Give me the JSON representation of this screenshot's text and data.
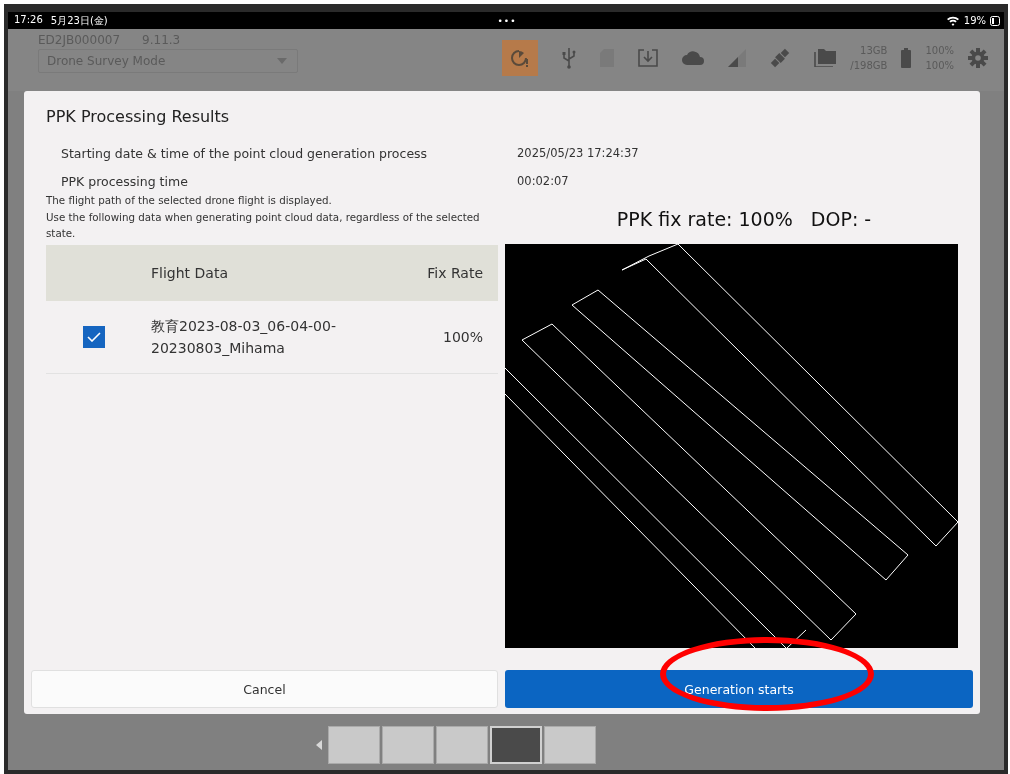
{
  "status_bar": {
    "time": "17:26",
    "date": "5月23日(金)",
    "dots": "•••",
    "battery": "19%"
  },
  "header": {
    "device": "ED2JB000007",
    "version": "9.11.3",
    "mode": "Drone Survey Mode",
    "storage_used": "13GB",
    "storage_total": "/198GB",
    "battery_1": "100%",
    "battery_2": "100%"
  },
  "dialog": {
    "title": "PPK Processing Results",
    "info": [
      {
        "label": "Starting date & time of the point cloud generation process",
        "value": "2025/05/23 17:24:37"
      },
      {
        "label": "PPK processing time",
        "value": "00:02:07"
      }
    ],
    "note": [
      "The flight path of the selected drone flight is displayed.",
      "Use the following data when generating point cloud data, regardless of the selected state."
    ],
    "table": {
      "columns": [
        "Flight Data",
        "Fix Rate"
      ],
      "rows": [
        {
          "checked": true,
          "name": "教育2023-08-03_06-04-00-20230803_Mihama",
          "fix_rate": "100%"
        }
      ]
    },
    "summary": {
      "fix_rate": "PPK fix rate: 100%",
      "dop": "DOP: -"
    },
    "buttons": [
      {
        "kind": "secondary",
        "label": "Cancel"
      },
      {
        "kind": "primary",
        "label": "Generation starts"
      }
    ]
  },
  "annotations": [
    {
      "kind": "ellipse"
    }
  ],
  "thumbnails": [
    {
      "selected": false
    },
    {
      "selected": false
    },
    {
      "selected": false
    },
    {
      "selected": true
    },
    {
      "selected": false
    }
  ]
}
